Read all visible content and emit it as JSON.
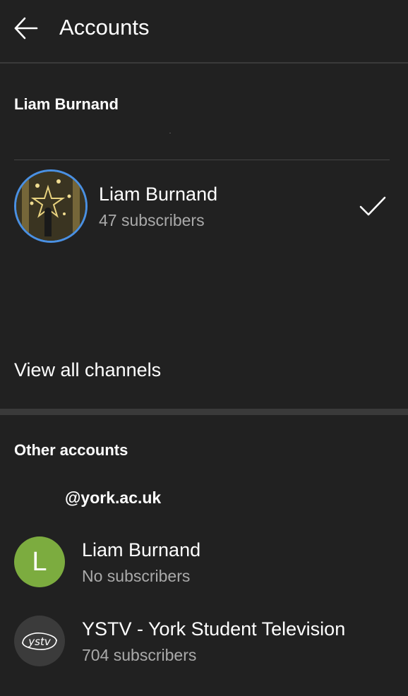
{
  "header": {
    "title": "Accounts",
    "back_icon": "arrow-left-icon"
  },
  "current_account": {
    "section_title": "Liam Burnand",
    "channel": {
      "name": "Liam Burnand",
      "subscribers": "47 subscribers",
      "selected": true,
      "avatar_ring_color": "#4a90e2"
    },
    "view_all_label": "View all channels"
  },
  "other_accounts": {
    "section_title": "Other accounts",
    "email": "@york.ac.uk",
    "channels": [
      {
        "name": "Liam Burnand",
        "subscribers": "No subscribers",
        "avatar_letter": "L",
        "avatar_color": "#7cac3f"
      },
      {
        "name": "YSTV - York Student Television",
        "subscribers": "704 subscribers",
        "avatar_text": "ystv"
      }
    ]
  }
}
